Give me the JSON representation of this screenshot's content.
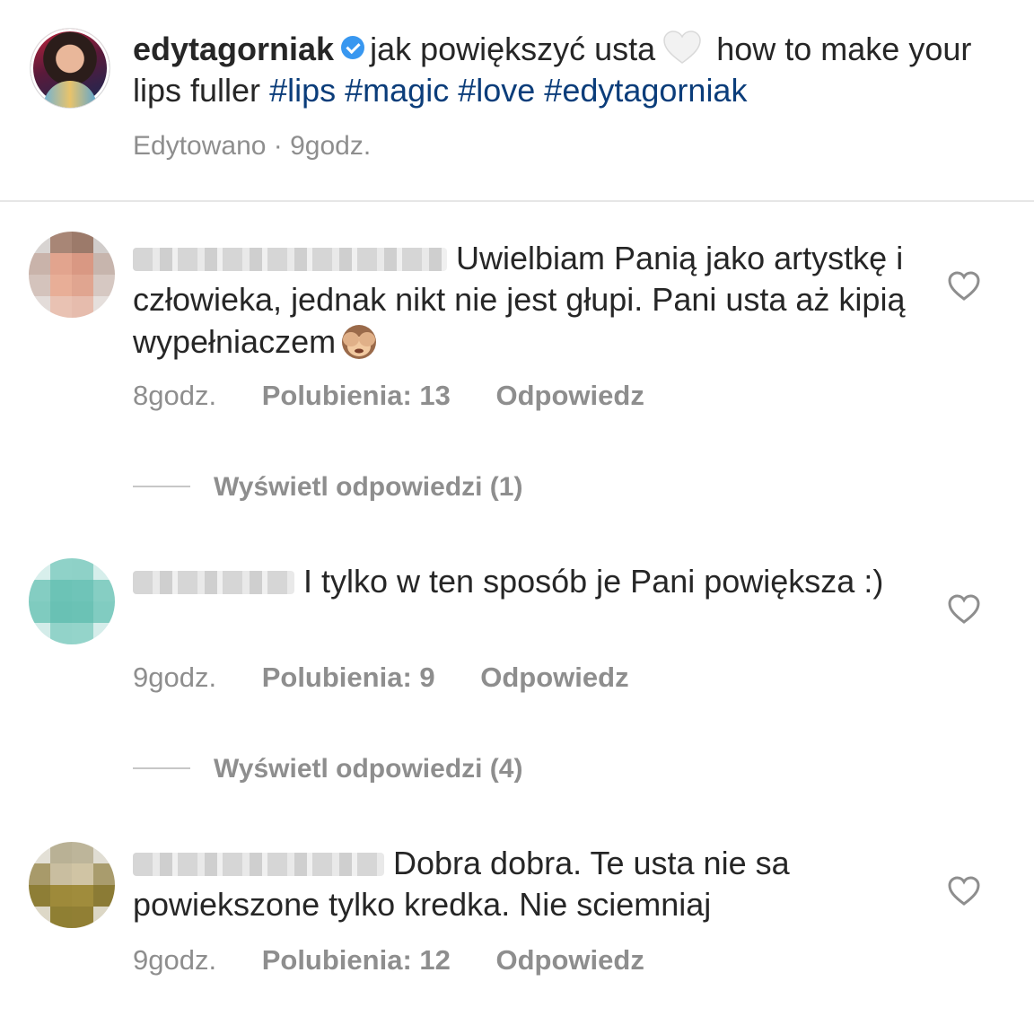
{
  "post": {
    "username": "edytagorniak",
    "caption_pl": "jak powiększyć usta",
    "caption_en": "how to make your lips fuller",
    "hashtags": [
      "#lips",
      "#magic",
      "#love",
      "#edytagorniak"
    ],
    "edited": "Edytowano",
    "time": "9godz.",
    "separator": "·"
  },
  "comments": [
    {
      "text": "Uwielbiam Panią jako artystkę i człowieka, jednak nikt nie jest głupi. Pani usta aż kipią wypełniaczem",
      "emoji": "see-no-evil-monkey",
      "time": "8godz.",
      "likes": "Polubienia: 13",
      "reply": "Odpowiedz",
      "view_replies": "Wyświetl odpowiedzi (1)"
    },
    {
      "text": "I tylko w ten sposób je Pani powiększa :)",
      "time": "9godz.",
      "likes": "Polubienia: 9",
      "reply": "Odpowiedz",
      "view_replies": "Wyświetl odpowiedzi (4)"
    },
    {
      "text": "Dobra dobra. Te usta nie sa powiekszone tylko kredka. Nie sciemniaj",
      "time": "9godz.",
      "likes": "Polubienia: 12",
      "reply": "Odpowiedz"
    }
  ],
  "colors": {
    "text": "#262626",
    "secondary": "#8e8e8e",
    "hashtag": "#0b3d7a",
    "verified": "#3897f0"
  },
  "icons": [
    "verified-badge-icon",
    "white-heart-emoji",
    "see-no-evil-monkey-emoji",
    "heart-outline-icon"
  ]
}
